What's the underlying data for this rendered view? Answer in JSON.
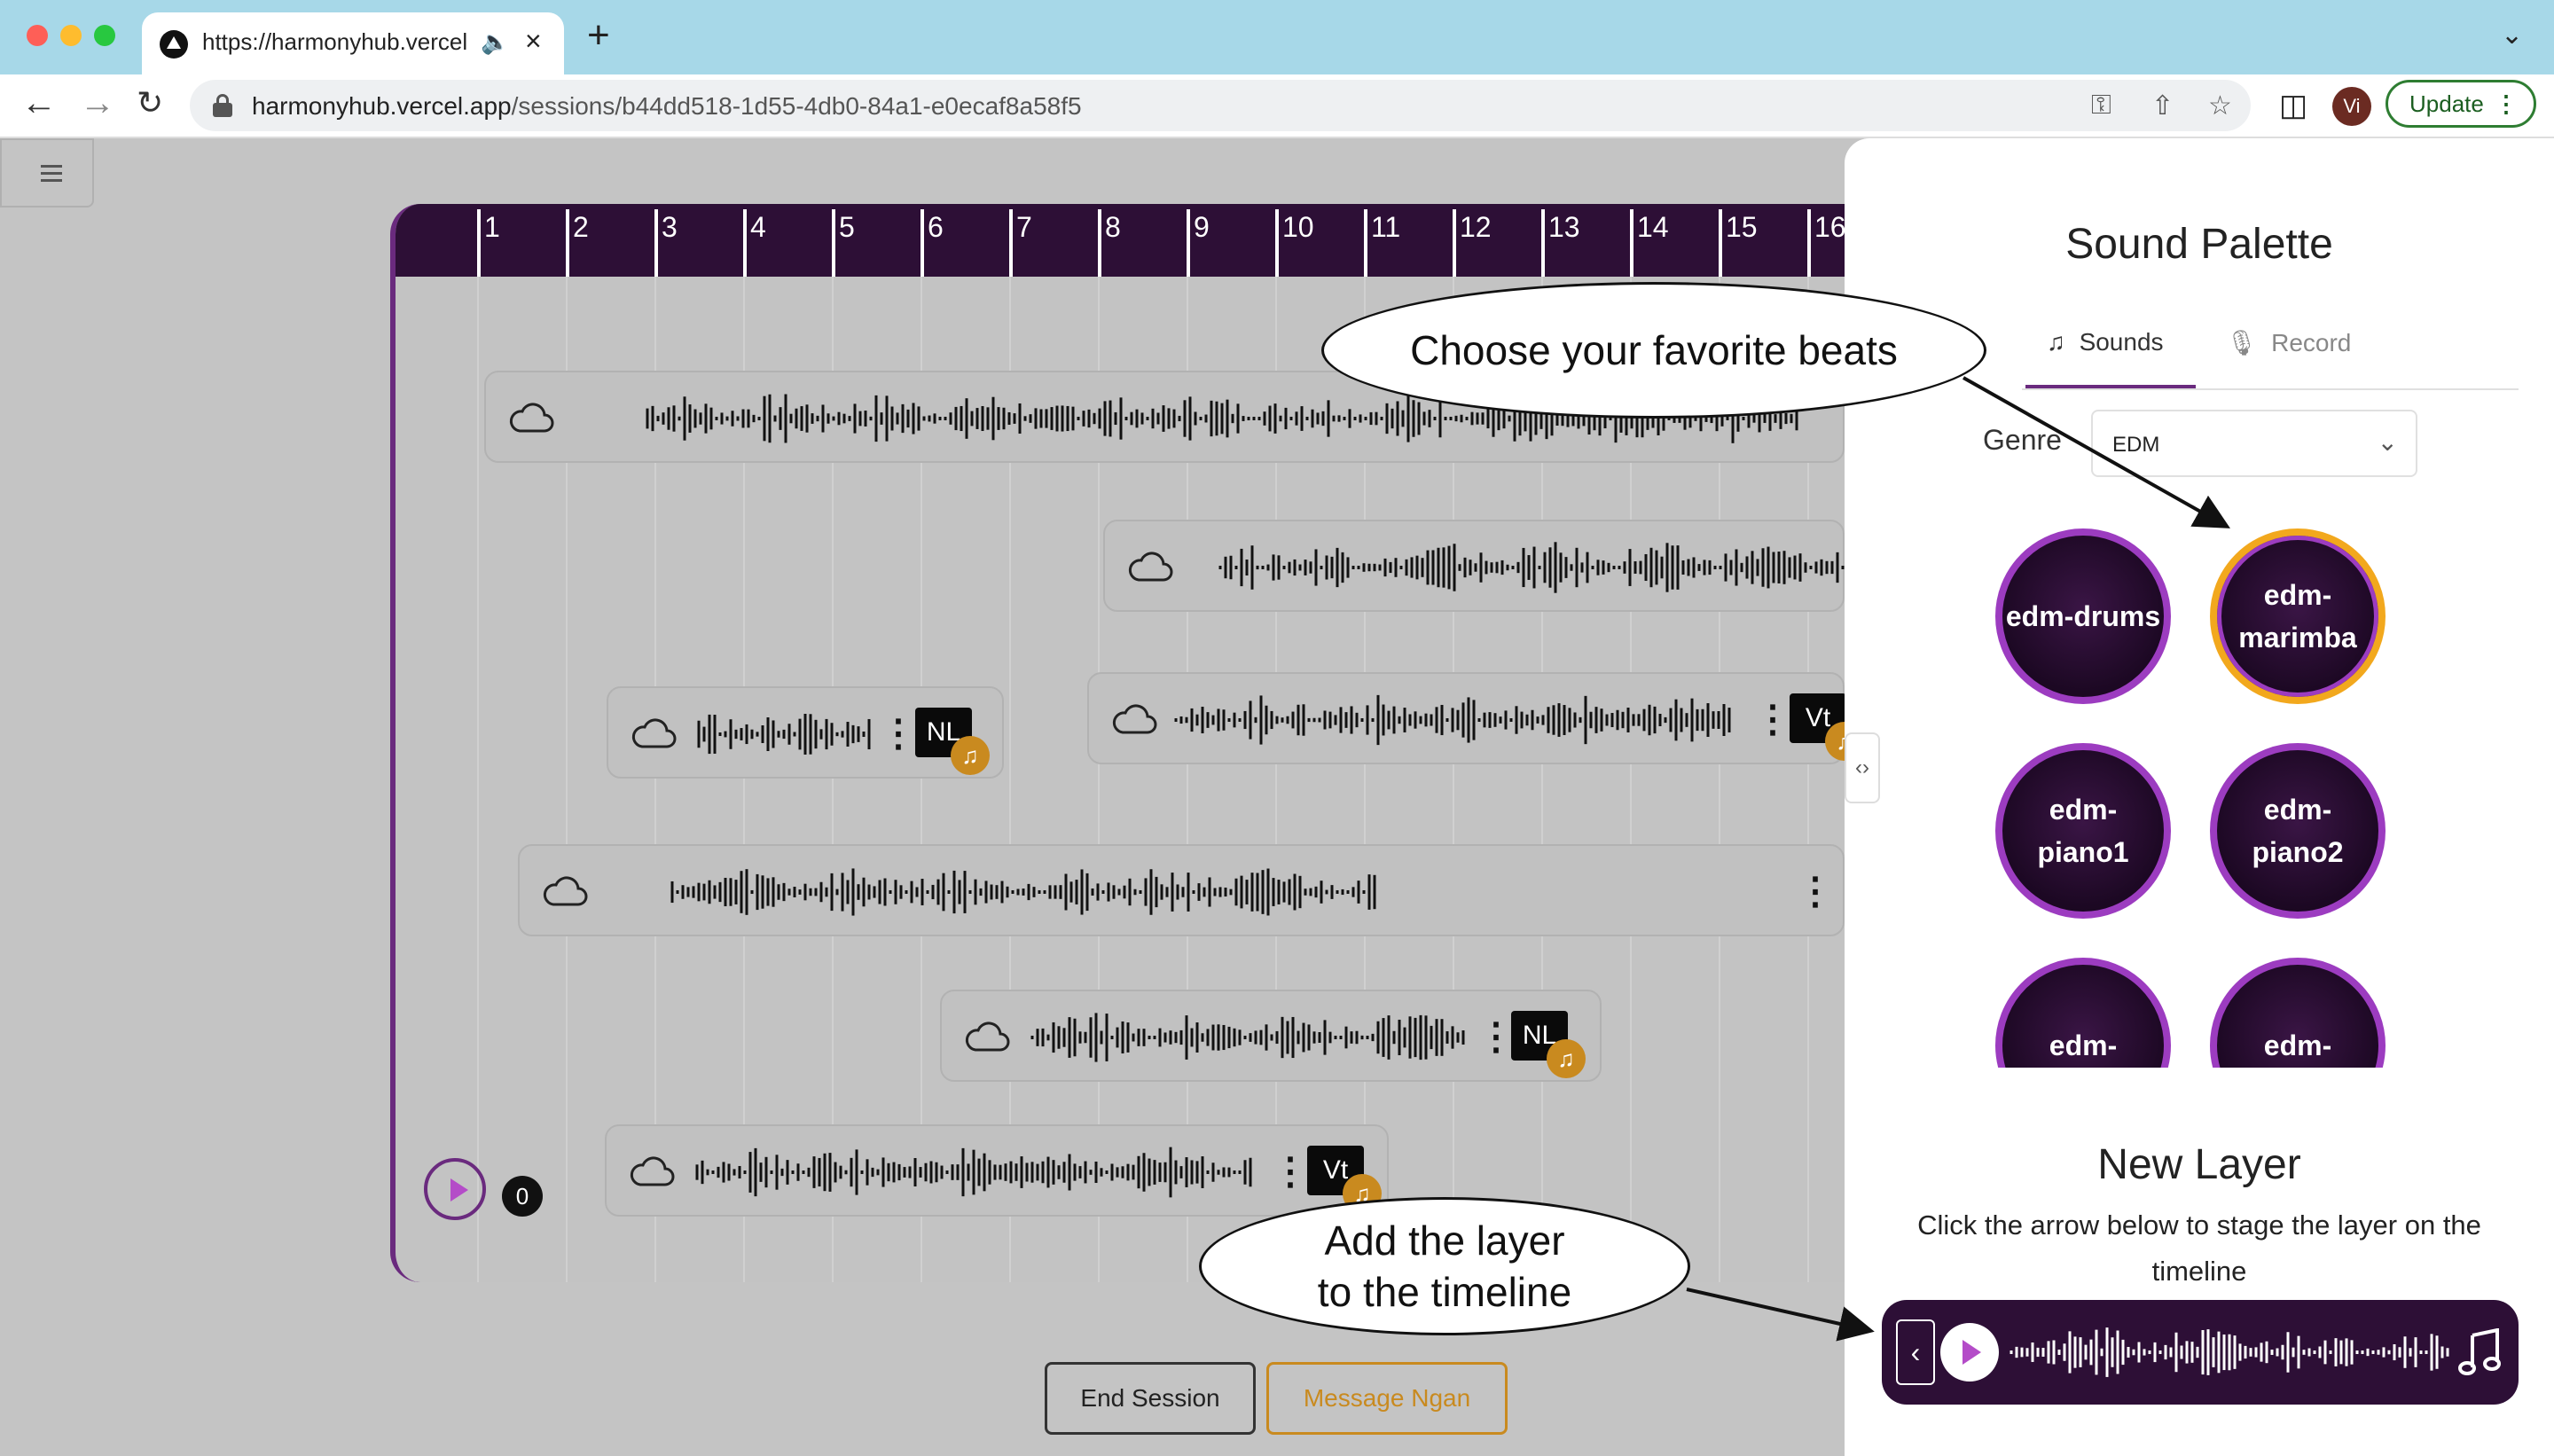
{
  "browser": {
    "tab_title": "https://harmonyhub.vercel.app",
    "tab_audio_icon": "speaker-icon",
    "url_domain": "harmonyhub.vercel.app",
    "url_path": "/sessions/b44dd518-1d55-4db0-84a1-e0ecaf8a58f5",
    "profile_initials": "Vi",
    "update_label": "Update"
  },
  "timeline": {
    "ruler_numbers": [
      "1",
      "2",
      "3",
      "4",
      "5",
      "6",
      "7",
      "8",
      "9",
      "10",
      "11",
      "12",
      "13",
      "14",
      "15",
      "16"
    ],
    "counter": "0",
    "tracks": [
      {
        "badge": ""
      },
      {
        "badge": ""
      },
      {
        "badge": "NL"
      },
      {
        "badge": "Vt"
      },
      {
        "badge": ""
      },
      {
        "badge": "NL"
      },
      {
        "badge": "Vt"
      }
    ]
  },
  "footer": {
    "end_session": "End Session",
    "message": "Message Ngan"
  },
  "panel": {
    "title": "Sound Palette",
    "tabs": [
      {
        "label": "Sounds",
        "icon": "music-note-icon"
      },
      {
        "label": "Record",
        "icon": "microphone-icon"
      }
    ],
    "genre_label": "Genre",
    "genre_value": "EDM",
    "sounds": [
      {
        "label": "edm-drums",
        "selected": false
      },
      {
        "label": "edm-\nmarimba",
        "selected": true
      },
      {
        "label": "edm-\npiano1",
        "selected": false
      },
      {
        "label": "edm-\npiano2",
        "selected": false
      },
      {
        "label": "edm-",
        "selected": false
      },
      {
        "label": "edm-",
        "selected": false
      }
    ],
    "new_layer_title": "New Layer",
    "new_layer_desc": "Click the arrow below to stage the layer on the timeline"
  },
  "annotations": {
    "beats": "Choose your favorite beats",
    "add_layer_line1": "Add the layer",
    "add_layer_line2": "to the timeline"
  },
  "colors": {
    "brand_dark": "#2d0f36",
    "brand_purple": "#9c3cc0",
    "accent_orange": "#c98a1f",
    "selected_ring": "#f2a81d"
  }
}
